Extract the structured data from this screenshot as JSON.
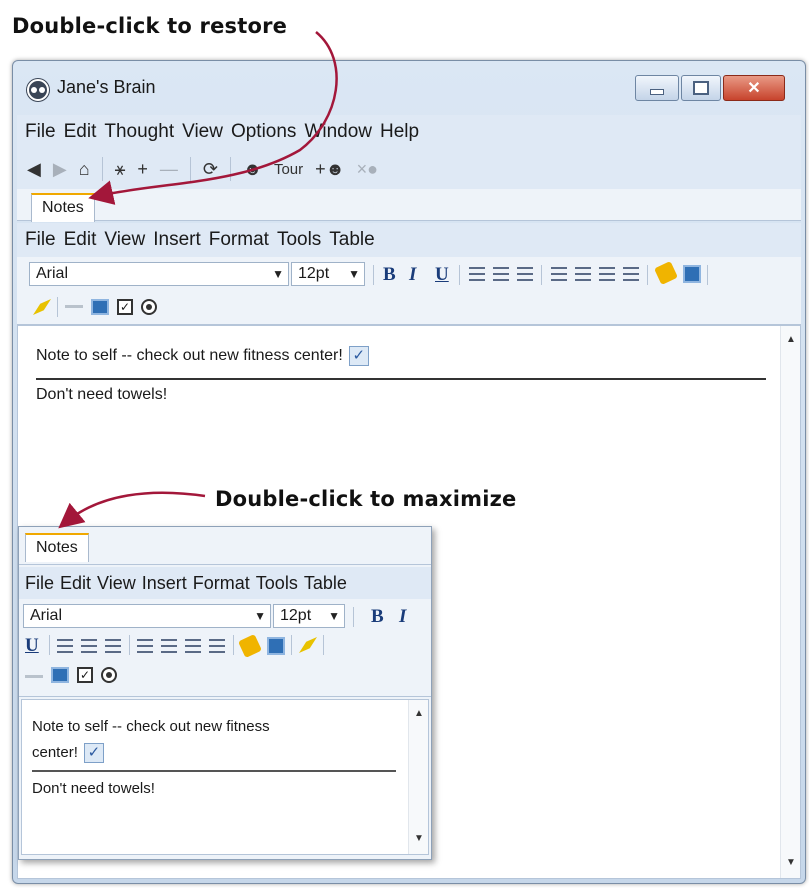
{
  "callouts": {
    "restore": "Double-click to restore",
    "maximize": "Double-click to maximize"
  },
  "window": {
    "title": "Jane's Brain",
    "menu": [
      "File",
      "Edit",
      "Thought",
      "View",
      "Options",
      "Window",
      "Help"
    ],
    "nav": {
      "tour_label": "Tour"
    },
    "tab": "Notes"
  },
  "editor": {
    "menu": [
      "File",
      "Edit",
      "View",
      "Insert",
      "Format",
      "Tools",
      "Table"
    ],
    "font": "Arial",
    "size": "12pt",
    "bold": "B",
    "italic": "I",
    "underline": "U"
  },
  "note": {
    "line1": "Note to self -- check out new fitness center!",
    "line2": "Don't need towels!",
    "small_line1a": "Note to self -- check out new fitness",
    "small_line1b": "center!",
    "checked": true
  },
  "colors": {
    "tab_accent": "#f0a800",
    "arrow": "#a3173a",
    "close_button": "#c7432c"
  },
  "icons": [
    "back-icon",
    "forward-icon",
    "home-icon",
    "plex-icon",
    "plus-icon",
    "minus-icon",
    "refresh-icon",
    "tour-icon",
    "add-brain-icon",
    "remove-brain-icon",
    "minimize-icon",
    "maximize-icon",
    "close-icon"
  ]
}
